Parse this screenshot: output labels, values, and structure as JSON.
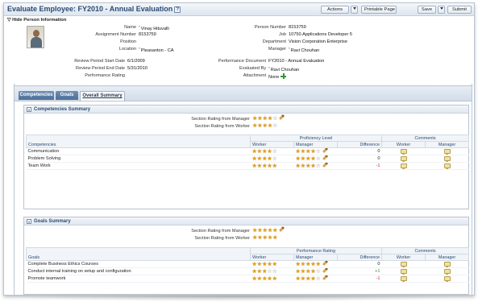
{
  "header": {
    "title": "Evaluate Employee: FY2010 - Annual Evaluation",
    "help_icon": "?",
    "buttons": {
      "actions": "Actions",
      "printable": "Printable Page",
      "save": "Save",
      "submit": "Submit"
    }
  },
  "person": {
    "toggle": "Hide Person Information",
    "left": {
      "name_label": "Name",
      "name_value": "Vinay Hituvalli",
      "assignment_label": "Assignment Number",
      "assignment_value": "8153759",
      "position_label": "Position",
      "position_value": "",
      "location_label": "Location",
      "location_value": "Pleasanton - CA"
    },
    "right": {
      "person_number_label": "Person Number",
      "person_number_value": "8153759",
      "job_label": "Job",
      "job_value": "10750.Applications Developer 5",
      "department_label": "Department",
      "department_value": "Vision Corporation Enterprise",
      "manager_label": "Manager",
      "manager_value": "Ravi Chouhan"
    },
    "review": {
      "start_label": "Review Period Start Date",
      "start_value": "6/1/2009",
      "end_label": "Review Period End Date",
      "end_value": "5/31/2010",
      "rating_label": "Performance Rating",
      "rating_value": "",
      "doc_label": "Performance Document",
      "doc_value": "FY2010 - Annual Evaluation",
      "evaluated_label": "Evaluated By",
      "evaluated_value": "Ravi Chouhan",
      "attachment_label": "Attachment",
      "attachment_value": "None"
    }
  },
  "tabs": [
    {
      "label": "Competencies",
      "active": false
    },
    {
      "label": "Goals",
      "active": false
    },
    {
      "label": "Overall Summary",
      "active": true
    }
  ],
  "competencies": {
    "title": "Competencies Summary",
    "manager_rating_label": "Section Rating from Manager",
    "manager_rating": 4,
    "worker_rating_label": "Section Rating from Worker",
    "worker_rating": 4,
    "group_header": "Proficiency Level",
    "comments_header": "Comments",
    "columns": {
      "name": "Competencies",
      "worker": "Worker",
      "manager": "Manager",
      "difference": "Difference",
      "c_worker": "Worker",
      "c_manager": "Manager"
    },
    "rows": [
      {
        "name": "Communication",
        "worker": 4,
        "manager": 4,
        "difference": "0"
      },
      {
        "name": "Problem Solving",
        "worker": 4,
        "manager": 4,
        "difference": "0"
      },
      {
        "name": "Team Work",
        "worker": 5,
        "manager": 4,
        "difference": "-1"
      }
    ]
  },
  "goals": {
    "title": "Goals Summary",
    "manager_rating_label": "Section Rating from Manager",
    "manager_rating": 5,
    "worker_rating_label": "Section Rating from Worker",
    "worker_rating": 5,
    "group_header": "Performance Rating",
    "comments_header": "Comments",
    "columns": {
      "name": "Goals",
      "worker": "Worker",
      "manager": "Manager",
      "difference": "Difference",
      "c_worker": "Worker",
      "c_manager": "Manager"
    },
    "rows": [
      {
        "name": "Complete Business Ethics Courses",
        "worker": 5,
        "manager": 5,
        "difference": "0"
      },
      {
        "name": "Conduct internal training on setup and configuration",
        "worker": 3,
        "manager": 4,
        "difference": "+1"
      },
      {
        "name": "Promote teamwork",
        "worker": 5,
        "manager": 4,
        "difference": "-1"
      }
    ]
  },
  "colors": {
    "title": "#2a4a73",
    "star": "#e6a218",
    "negative": "#d21f1f",
    "positive": "#2f8a2f"
  }
}
